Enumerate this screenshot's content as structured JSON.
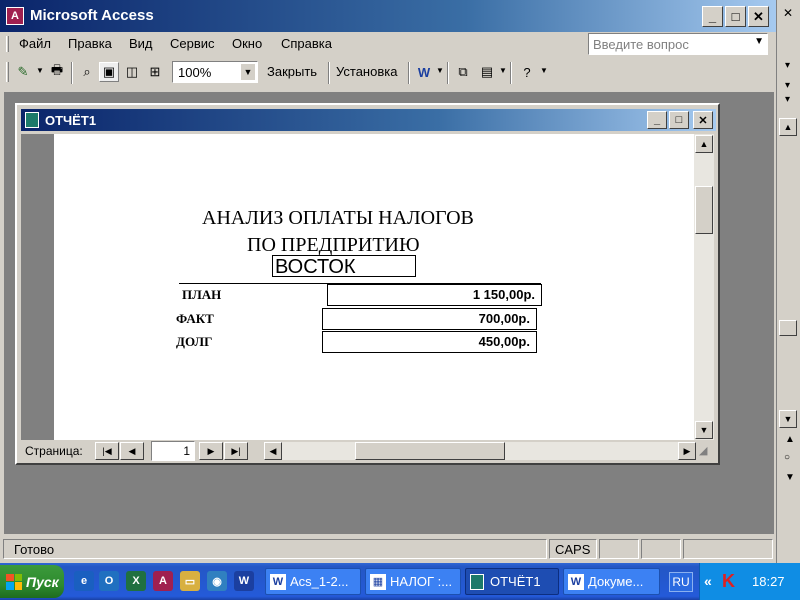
{
  "app": {
    "title": "Microsoft Access"
  },
  "menu": {
    "items": [
      "Файл",
      "Правка",
      "Вид",
      "Сервис",
      "Окно",
      "Справка"
    ],
    "help_placeholder": "Введите вопрос"
  },
  "toolbar": {
    "zoom": "100%",
    "close_label": "Закрыть",
    "setup_label": "Установка"
  },
  "report_window": {
    "title": "ОТЧЁТ1"
  },
  "report": {
    "title_line1": "АНАЛИЗ ОПЛАТЫ НАЛОГОВ",
    "title_line2": "ПО ПРЕДПРИТИЮ",
    "company": "ВОСТОК",
    "rows": [
      {
        "label": "ПЛАН",
        "value": "1 150,00р."
      },
      {
        "label": "ФАКТ",
        "value": "700,00р."
      },
      {
        "label": "ДОЛГ",
        "value": "450,00р."
      }
    ]
  },
  "nav": {
    "page_label": "Страница:",
    "page_number": "1"
  },
  "status": {
    "text": "Готово",
    "caps": "CAPS"
  },
  "taskbar": {
    "start_label": "Пуск",
    "tasks": [
      "Acs_1-2...",
      "НАЛОГ :...",
      "ОТЧЁТ1",
      "Докуме..."
    ],
    "lang": "RU",
    "clock": "18:27"
  }
}
